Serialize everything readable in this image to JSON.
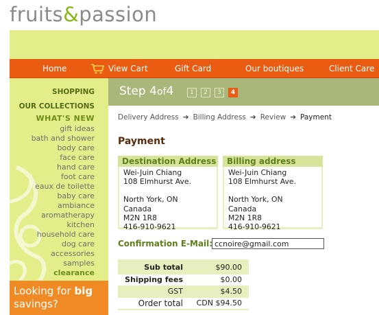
{
  "brand": {
    "name_part1": "fruits",
    "amp": "&",
    "name_part2": "passion",
    "accent_color": "#86b818"
  },
  "nav": {
    "items": [
      "Home",
      "View Cart",
      "Gift Card",
      "Our boutiques",
      "Client Care"
    ],
    "color": "#e95c12"
  },
  "sidebar": {
    "shopping": "SHOPPING",
    "collections": "OUR COLLECTIONS",
    "whats_new": "WHAT'S NEW",
    "links": [
      "gift ideas",
      "bath and shower",
      "body care",
      "face care",
      "hand care",
      "foot care",
      "eaux de toilette",
      "baby care",
      "ambiance",
      "aromatherapy",
      "kitchen",
      "household care",
      "dog care",
      "accessories",
      "samples"
    ],
    "clearance": "clearance"
  },
  "promo": {
    "line1": "Looking for ",
    "bold": "big",
    "line2": "savings?"
  },
  "steps": {
    "label_prefix": "Step ",
    "current": "4",
    "label_of": "of",
    "total": "4",
    "boxes": [
      "1",
      "2",
      "3",
      "4"
    ]
  },
  "breadcrumb": {
    "items": [
      "Delivery Address",
      "Billing Address",
      "Review",
      "Payment"
    ],
    "arrow": "➔"
  },
  "page_title": "Payment",
  "destination": {
    "heading": "Destination Address",
    "lines": [
      "Wei-Juin Chiang",
      "108 Elmhurst Ave.",
      "",
      "North York, ON",
      "Canada",
      "M2N 1R8",
      "416-910-9621"
    ]
  },
  "billing": {
    "heading": "Billing address",
    "lines": [
      "Wei-Juin Chiang",
      "108 Elmhurst Ave.",
      "",
      "North York, ON",
      "Canada",
      "M2N 1R8",
      "416-910-9621"
    ]
  },
  "email": {
    "label": "Confirmation E-Mail:",
    "value": "ccnoire@gmail.com"
  },
  "totals": {
    "subtotal_label": "Sub total",
    "subtotal": "$90.00",
    "shipping_label": "Shipping fees",
    "shipping": "$0.00",
    "gst_label": "GST",
    "gst": "$4.50",
    "order_label": "Order total",
    "order": "CDN $94.50"
  }
}
